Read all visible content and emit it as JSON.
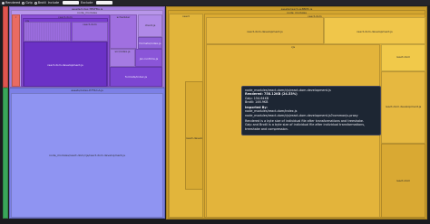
{
  "toolbar": {
    "options": [
      {
        "label": "Rendered",
        "selected": true
      },
      {
        "label": "Gzip",
        "selected": false
      },
      {
        "label": "Brotli",
        "selected": false
      },
      {
        "label": "Include",
        "selected": false
      }
    ],
    "search_placeholder": "",
    "exclude_label": "Exclude"
  },
  "colors": {
    "background": "#1b1b1f",
    "purple": "#a37ee0",
    "purple_deep": "#6b31c6",
    "periwinkle": "#8f94f2",
    "gold": "#d7a72d",
    "gold_light": "#f1c94a",
    "red": "#e0554f",
    "green": "#3aa65a"
  },
  "tiles": {
    "left_root": "assets/index-TBSFBq.js",
    "node_modules": "node_modules",
    "r_label": "r",
    "react_dom": "react-dom",
    "cjs": "cjs",
    "react_dom_dev": "react-dom.development.js",
    "react_dom_small": "react-dom",
    "scheduler": "scheduler",
    "client": "client.js",
    "formats": "formats/index.js",
    "formats2": "formats/index.js",
    "src_index": "src/index.js",
    "jsx_runtime": "jsx-runtime.js",
    "dev_index": "index.js",
    "lower_root": "assets/index-P7F4d-A.js",
    "lower_file": "node_modules/react-dom/cjs/react-dom.development.js",
    "right_root": "assets/react-us3BJJfk.js",
    "right_nm": "node_modules",
    "react": "react",
    "right_cjs": "cjs",
    "react_dev": "react.development.js",
    "react_dom_pkg": "react-dom",
    "right_react_dev2": "react-dom.development.js",
    "right_react_dev3": "react-dom.development.js",
    "rd_a": "react.dom",
    "rd_b": "react-dom.development.js",
    "rd_c": "react-dom"
  },
  "tooltip": {
    "path": "node_modules/react-dom/cjs/react-dom.development.js",
    "rendered": "Rendered: 758.12KB (24.53%)",
    "gzip": "Gzip: 154.64KB",
    "brotli": "Brotli: 146.9KB",
    "imported_by_title": "Imported By:",
    "imported_by_1": "node_modules/react-dom/index.js",
    "imported_by_2": "node_modules/react-dom/cjs/react-dom.development.js?commonjs-proxy",
    "note_1": "Rendered is a byte size of individual file after transformations and treeshake.",
    "note_2": "Gzip and Brotli is a byte size of individual file after individual transformations,",
    "note_3": "treeshake and compression."
  }
}
